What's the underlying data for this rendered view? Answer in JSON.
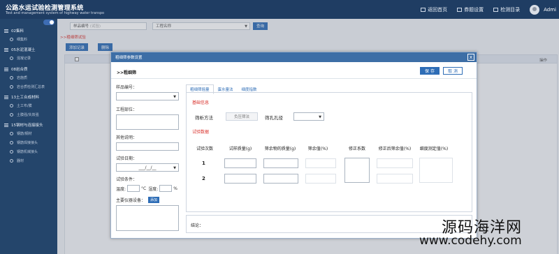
{
  "app": {
    "title": "公路水运试验检测管理系统",
    "subtitle": "Test and management system of highway water transpo"
  },
  "header": {
    "nav": [
      "返回首页",
      "券题设置",
      "检测目录"
    ],
    "user": "Admi"
  },
  "sidebar": {
    "items": [
      {
        "type": "group",
        "label": "02集料"
      },
      {
        "type": "item",
        "label": "细集料"
      },
      {
        "type": "group",
        "label": "05水泥混凝土"
      },
      {
        "type": "item",
        "label": "混凝记录"
      },
      {
        "type": "group",
        "label": "08岩合质"
      },
      {
        "type": "item",
        "label": "岩施质"
      },
      {
        "type": "item",
        "label": "岩合质检测汇总表"
      },
      {
        "type": "group",
        "label": "13土工合成材料"
      },
      {
        "type": "item",
        "label": "土工布/膜"
      },
      {
        "type": "item",
        "label": "土膜强/失效强"
      },
      {
        "type": "group",
        "label": "15钢材与连接接头"
      },
      {
        "type": "item",
        "label": "钢筋/钢材"
      },
      {
        "type": "item",
        "label": "钢筋焊接接头"
      },
      {
        "type": "item",
        "label": "钢筋机械接头"
      },
      {
        "type": "item",
        "label": "器材"
      }
    ]
  },
  "main": {
    "search_field": "样品编号",
    "search_placeholder": "(试验)",
    "project_field": "工程名称",
    "search_button": "查询",
    "crumb": ">>粗细筛试验",
    "add_button": "添加记录",
    "delete_button": "删除",
    "op_column": "操作"
  },
  "modal": {
    "title": "粗细筛参数设置",
    "close": "x",
    "crumb": ">>粗细筛",
    "save": "保 存",
    "close_button": "取 消",
    "left": {
      "sample_no": "样品编号：",
      "project_part": "工程部位：",
      "other_desc": "其他说明：",
      "test_date": "试验日期：",
      "date_value": "___/__/__",
      "test_cond": "试验条件：",
      "temp_label": "温度:",
      "temp_unit": "°C",
      "humidity_label": "湿度:",
      "humidity_unit": "%",
      "equipment": "主要仪器设备：",
      "add_tag": "添加"
    },
    "tabs": [
      "粗细筛摇量",
      "蛋水量法",
      "细度指数"
    ],
    "basic_info": "基础信息",
    "method_label": "筛析方法",
    "method_value": "负压筛法",
    "sieve_label": "筛孔孔径",
    "test_data": "试验数据",
    "columns": [
      "试验次数",
      "试样质量(g)",
      "筛余物的质量(g)",
      "筛余值(%)",
      "修正系数",
      "修正后筛余值(%)",
      "细度测定值(%)"
    ],
    "rows": [
      "1",
      "2"
    ],
    "remark": "结论："
  },
  "watermark": {
    "line1": "源码海洋网",
    "line2": "www.codehy.com"
  }
}
